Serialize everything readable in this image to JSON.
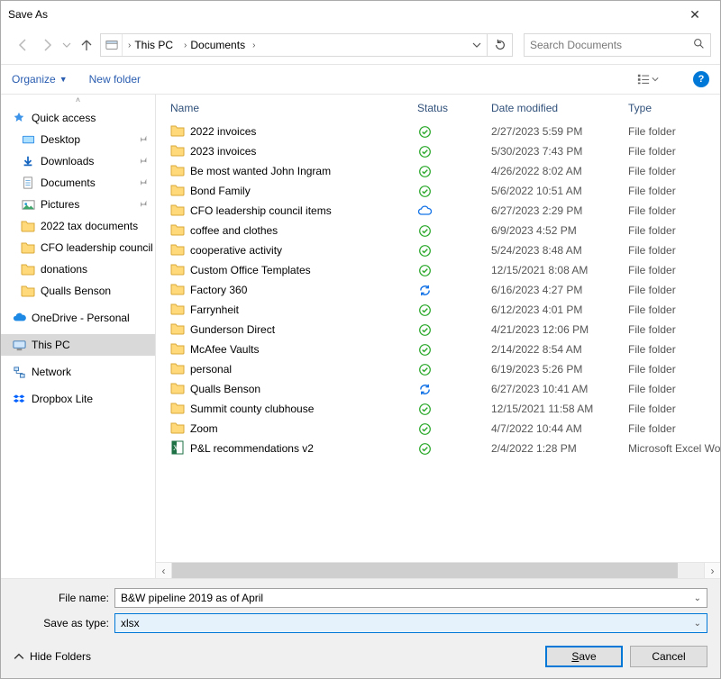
{
  "title": "Save As",
  "address": {
    "segments": [
      "This PC",
      "Documents"
    ]
  },
  "search": {
    "placeholder": "Search Documents"
  },
  "toolbar": {
    "organize": "Organize",
    "newfolder": "New folder"
  },
  "columns": {
    "name": "Name",
    "status": "Status",
    "date": "Date modified",
    "type": "Type"
  },
  "sidebar": {
    "quick_access": "Quick access",
    "pinned": [
      {
        "label": "Desktop"
      },
      {
        "label": "Downloads"
      },
      {
        "label": "Documents"
      },
      {
        "label": "Pictures"
      }
    ],
    "recent": [
      {
        "label": "2022 tax documents"
      },
      {
        "label": "CFO leadership council items"
      },
      {
        "label": "donations"
      },
      {
        "label": "Qualls Benson"
      }
    ],
    "onedrive": "OneDrive - Personal",
    "thispc": "This PC",
    "network": "Network",
    "dropbox": "Dropbox Lite"
  },
  "files": [
    {
      "name": "2022 invoices",
      "status": "synced",
      "date": "2/27/2023 5:59 PM",
      "type": "File folder",
      "icon": "folder"
    },
    {
      "name": "2023 invoices",
      "status": "synced",
      "date": "5/30/2023 7:43 PM",
      "type": "File folder",
      "icon": "folder"
    },
    {
      "name": "Be most wanted John Ingram",
      "status": "synced",
      "date": "4/26/2022 8:02 AM",
      "type": "File folder",
      "icon": "folder"
    },
    {
      "name": "Bond Family",
      "status": "synced",
      "date": "5/6/2022 10:51 AM",
      "type": "File folder",
      "icon": "folder"
    },
    {
      "name": "CFO leadership council items",
      "status": "cloud",
      "date": "6/27/2023 2:29 PM",
      "type": "File folder",
      "icon": "folder"
    },
    {
      "name": "coffee and clothes",
      "status": "synced",
      "date": "6/9/2023 4:52 PM",
      "type": "File folder",
      "icon": "folder"
    },
    {
      "name": "cooperative activity",
      "status": "synced",
      "date": "5/24/2023 8:48 AM",
      "type": "File folder",
      "icon": "folder"
    },
    {
      "name": "Custom Office Templates",
      "status": "synced",
      "date": "12/15/2021 8:08 AM",
      "type": "File folder",
      "icon": "folder"
    },
    {
      "name": "Factory 360",
      "status": "sync",
      "date": "6/16/2023 4:27 PM",
      "type": "File folder",
      "icon": "folder"
    },
    {
      "name": "Farrynheit",
      "status": "synced",
      "date": "6/12/2023 4:01 PM",
      "type": "File folder",
      "icon": "folder"
    },
    {
      "name": "Gunderson Direct",
      "status": "synced",
      "date": "4/21/2023 12:06 PM",
      "type": "File folder",
      "icon": "folder"
    },
    {
      "name": "McAfee Vaults",
      "status": "synced",
      "date": "2/14/2022 8:54 AM",
      "type": "File folder",
      "icon": "folder"
    },
    {
      "name": "personal",
      "status": "synced",
      "date": "6/19/2023 5:26 PM",
      "type": "File folder",
      "icon": "folder"
    },
    {
      "name": "Qualls Benson",
      "status": "sync",
      "date": "6/27/2023 10:41 AM",
      "type": "File folder",
      "icon": "folder"
    },
    {
      "name": "Summit county clubhouse",
      "status": "synced",
      "date": "12/15/2021 11:58 AM",
      "type": "File folder",
      "icon": "folder"
    },
    {
      "name": "Zoom",
      "status": "synced",
      "date": "4/7/2022 10:44 AM",
      "type": "File folder",
      "icon": "folder"
    },
    {
      "name": "P&L recommendations v2",
      "status": "synced",
      "date": "2/4/2022 1:28 PM",
      "type": "Microsoft Excel Worksheet",
      "icon": "excel"
    }
  ],
  "footer": {
    "filename_label": "File name:",
    "filename_value": "B&W pipeline 2019 as of April",
    "type_label": "Save as type:",
    "type_value": "xlsx",
    "hide_folders": "Hide Folders",
    "save": "Save",
    "cancel": "Cancel"
  }
}
